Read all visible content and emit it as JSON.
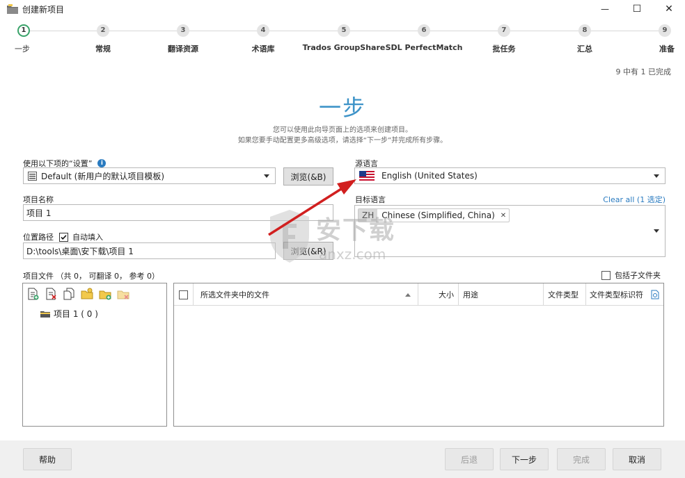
{
  "window": {
    "title": "创建新项目",
    "minimize": "—",
    "maximize": "☐",
    "close": "✕"
  },
  "steps": [
    {
      "num": "1",
      "label": "一步",
      "active": true
    },
    {
      "num": "2",
      "label": "常规"
    },
    {
      "num": "3",
      "label": "翻译资源"
    },
    {
      "num": "4",
      "label": "术语库"
    },
    {
      "num": "5",
      "label": "Trados GroupShare"
    },
    {
      "num": "6",
      "label": "SDL PerfectMatch"
    },
    {
      "num": "7",
      "label": "批任务"
    },
    {
      "num": "8",
      "label": "汇总"
    },
    {
      "num": "9",
      "label": "准备"
    }
  ],
  "progress": "9 中有 1 已完成",
  "heading": "一步",
  "description": [
    "您可以使用此向导页面上的选项来创建项目。",
    "如果您要手动配置更多高级选项，请选择“下一步”并完成所有步骤。"
  ],
  "settings": {
    "label": "使用以下项的“设置”",
    "info_icon": "i",
    "value": "Default (新用户的默认项目模板)",
    "browse": "浏览(&B)"
  },
  "source_lang": {
    "label": "源语言",
    "value": "English (United States)"
  },
  "project_name": {
    "label": "项目名称",
    "value": "项目 1"
  },
  "target_lang": {
    "label": "目标语言",
    "clear_all": "Clear all (1 选定)",
    "chip_code": "ZH",
    "chip_label": "Chinese (Simplified, China)",
    "chip_remove": "✕"
  },
  "location": {
    "label": "位置路径",
    "auto_label": "自动填入",
    "auto_checked": true,
    "value": "D:\\tools\\桌面\\安下载\\项目 1",
    "browse": "浏览(&R)"
  },
  "files": {
    "label": "项目文件 （共 0， 可翻译 0， 参考 0）",
    "include_subfolders": "包括子文件夹",
    "tree_item": "项目 1 ( 0 )",
    "columns": {
      "name": "所选文件夹中的文件",
      "size": "大小",
      "usage": "用途",
      "type": "文件类型",
      "type_id": "文件类型标识符"
    }
  },
  "watermark": {
    "text": "安下载",
    "sub": "anxz.com"
  },
  "footer": {
    "help": "帮助",
    "back": "后退",
    "next": "下一步",
    "finish": "完成",
    "cancel": "取消"
  },
  "colors": {
    "accent": "#3d93c8",
    "step_active": "#3aa36a",
    "link": "#2a7bc0",
    "arrow": "#d11f1f"
  }
}
